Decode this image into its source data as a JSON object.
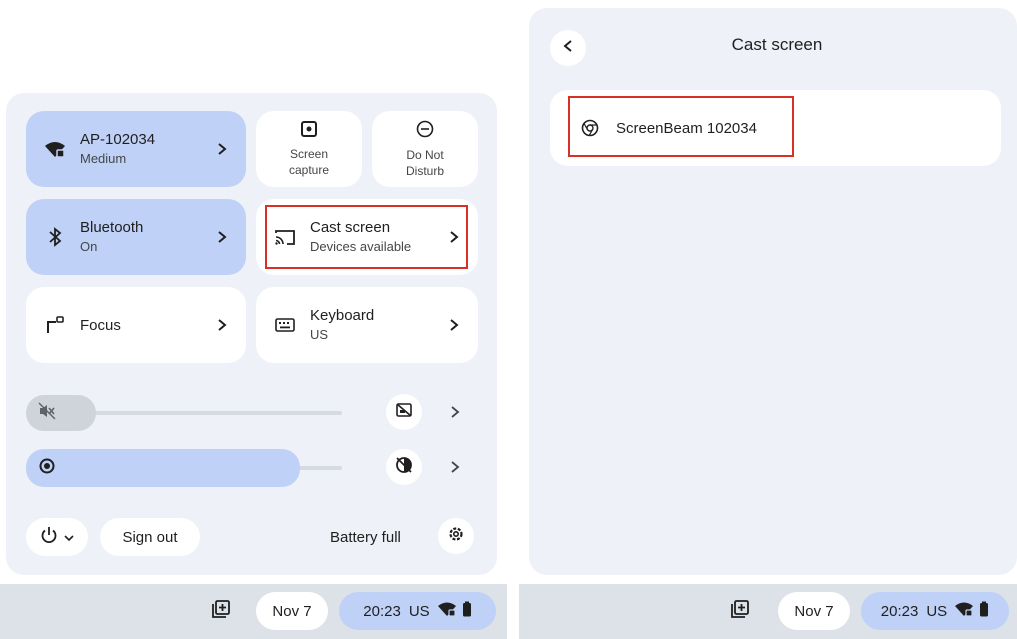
{
  "quick_settings": {
    "network_tile": {
      "name": "AP-102034",
      "status": "Medium",
      "icon": "wifi-locked-icon"
    },
    "screen_capture": {
      "label": "Screen capture",
      "icon": "screen-capture-icon"
    },
    "do_not_disturb": {
      "label": "Do Not Disturb",
      "icon": "do-not-disturb-icon"
    },
    "bluetooth_tile": {
      "name": "Bluetooth",
      "status": "On",
      "icon": "bluetooth-icon"
    },
    "cast_tile": {
      "name": "Cast screen",
      "status": "Devices available",
      "icon": "cast-icon"
    },
    "focus_tile": {
      "name": "Focus",
      "icon": "focus-icon"
    },
    "keyboard_tile": {
      "name": "Keyboard",
      "status": "US",
      "icon": "keyboard-icon"
    },
    "volume": {
      "muted": true,
      "level": 0,
      "icon": "volume-muted-icon"
    },
    "brightness": {
      "level": 0.9,
      "icon": "brightness-icon"
    },
    "sign_out_label": "Sign out",
    "battery_label": "Battery full"
  },
  "shelf": {
    "date": "Nov 7",
    "time": "20:23",
    "input_method": "US"
  },
  "cast_screen": {
    "title": "Cast screen",
    "devices": [
      {
        "name": "ScreenBeam 102034",
        "icon": "cast-device-icon"
      }
    ]
  },
  "colors": {
    "accent_tile": "#bfd1f7",
    "panel_bg": "#eef1f7",
    "highlight": "#d93025",
    "shelf_bg": "#dde1e8"
  }
}
